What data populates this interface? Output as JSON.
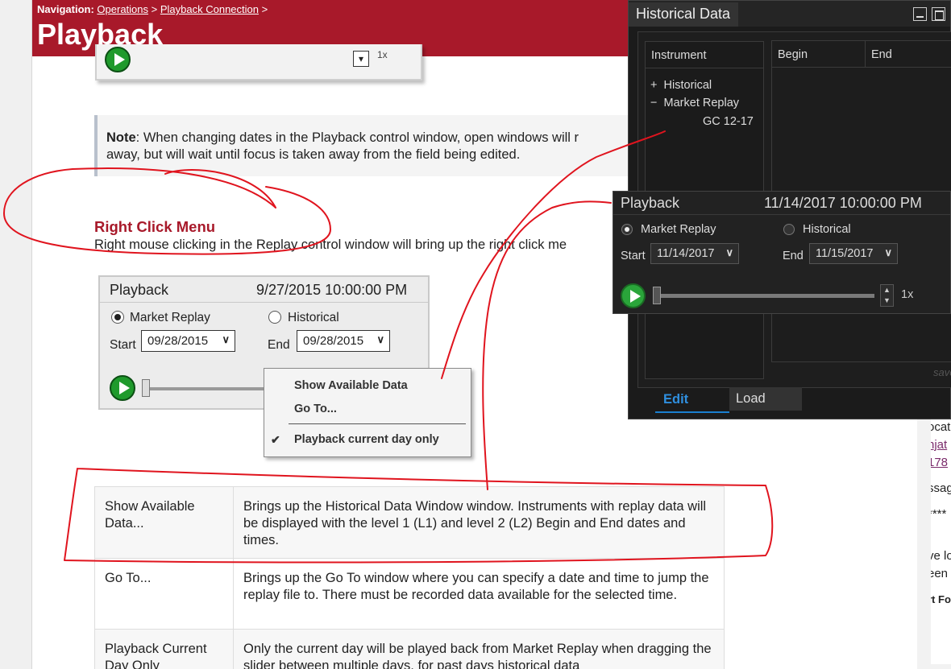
{
  "navigation": {
    "label": "Navigation:",
    "crumb_1": "Operations",
    "sep": ">",
    "crumb_2": "Playback Connection",
    "trail": ">"
  },
  "page_title": "Playback",
  "top_snip": {
    "speed": "1x"
  },
  "note": {
    "label": "Note",
    "text": ": When changing dates in the Playback control window, open windows will r",
    "text_2": "away, but will wait until focus is taken away from the field being edited."
  },
  "section": {
    "title": "Right Click Menu",
    "text": "Right mouse clicking in the Replay control window will bring up the right click me"
  },
  "playback_light": {
    "title": "Playback",
    "time": "9/27/2015 10:00:00 PM",
    "mode_market": "Market Replay",
    "mode_historical": "Historical",
    "start_label": "Start",
    "start_value": "09/28/2015",
    "end_label": "End",
    "end_value": "09/28/2015",
    "selected_mode": "Market Replay"
  },
  "context_menu": {
    "show_available": "Show Available Data",
    "go_to": "Go To...",
    "current_day": "Playback current day only"
  },
  "table": {
    "rows": [
      {
        "key": "Show Available Data...",
        "value": "Brings up the Historical Data Window window. Instruments with replay data will be displayed with the level 1 (L1) and level 2 (L2) Begin and End dates and times."
      },
      {
        "key": "Go To...",
        "value": "Brings up the Go To window where you can specify a date and time to jump the replay file to. There must be recorded data available for the selected time."
      },
      {
        "key": "Playback Current Day Only",
        "value": "Only the current day will be played back from Market Replay when dragging the slider between multiple days, for past days historical data"
      }
    ]
  },
  "historical_window": {
    "title": "Historical Data",
    "instrument_header": "Instrument",
    "tree_historical": "Historical",
    "tree_market_replay": "Market Replay",
    "tree_child": "GC 12-17",
    "col_begin": "Begin",
    "col_end": "End",
    "save_hint": "save",
    "tab_edit": "Edit",
    "tab_load": "Load"
  },
  "playback_dark": {
    "title": "Playback",
    "time": "11/14/2017 10:00:00 PM",
    "mode_market": "Market Replay",
    "mode_historical": "Historical",
    "start_label": "Start",
    "start_value": "11/14/2017",
    "end_label": "End",
    "end_value": "11/15/2017",
    "speed": "1x",
    "selected_mode": "Market Replay"
  },
  "right_panel": {
    "lines": [
      "ocat",
      "njat",
      "178",
      "ssag",
      "****",
      "ve lo",
      "een",
      "rt Fo"
    ]
  },
  "colors": {
    "brand_red": "#a8192a",
    "ink_red": "#e0141e",
    "play_green": "#1f9a2c",
    "edit_blue": "#2f8fdf"
  }
}
